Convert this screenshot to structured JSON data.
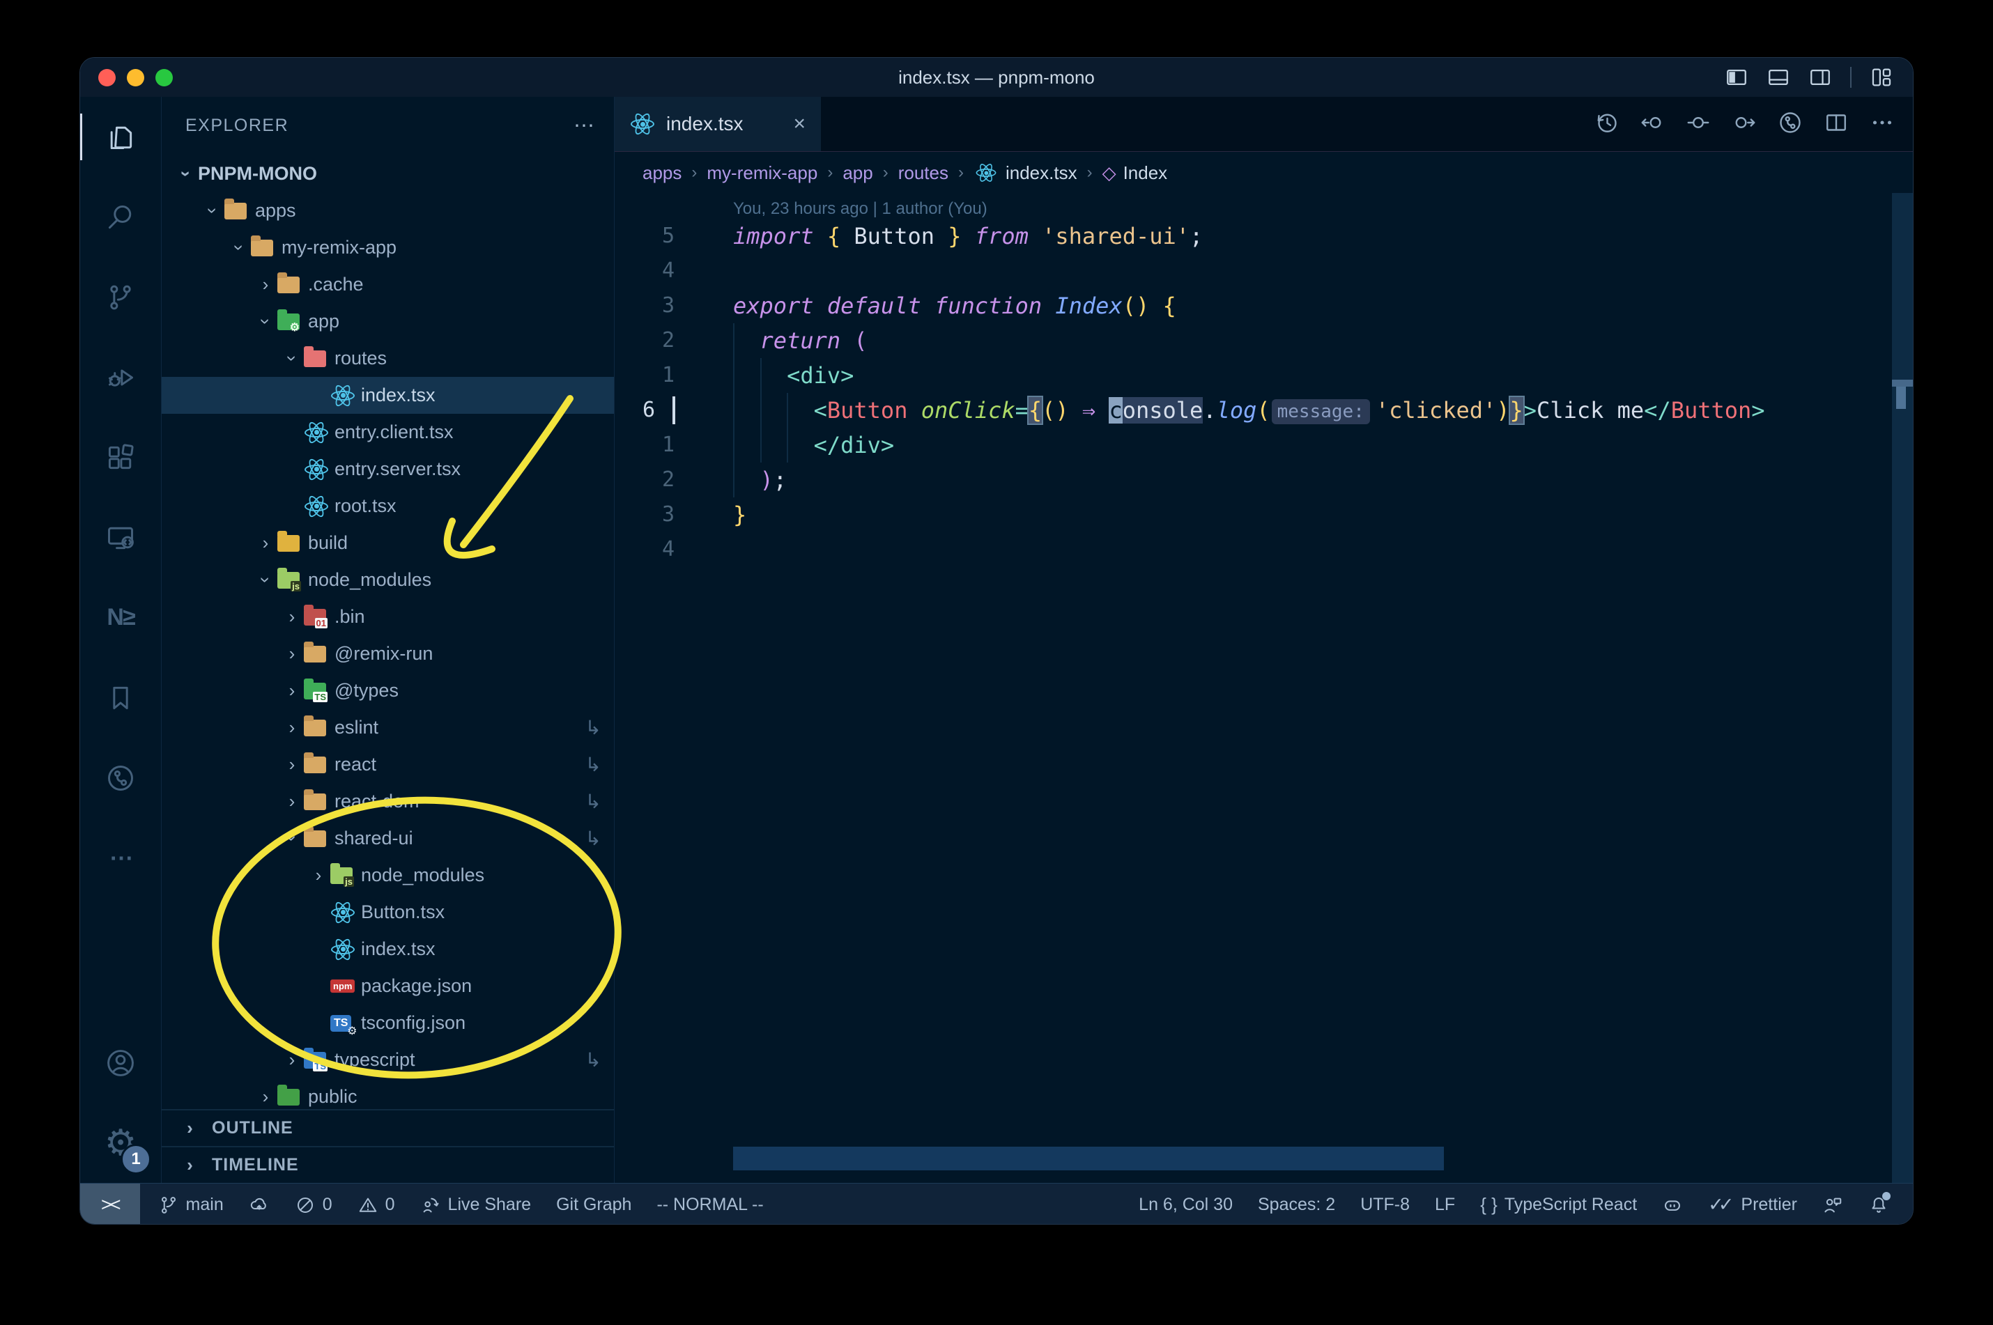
{
  "window": {
    "title": "index.tsx — pnpm-mono"
  },
  "titlebar": {
    "traffic_lights": [
      {
        "name": "close",
        "color": "#ff5f57"
      },
      {
        "name": "minimize",
        "color": "#febc2e"
      },
      {
        "name": "zoom",
        "color": "#28c840"
      }
    ],
    "layout_icons": [
      "layout-sidebar-left-icon",
      "layout-panel-icon",
      "layout-sidebar-right-icon",
      "customize-layout-icon"
    ]
  },
  "activity_bar": {
    "top": [
      {
        "name": "explorer",
        "icon": "files-icon",
        "active": true
      },
      {
        "name": "search",
        "icon": "search-icon"
      },
      {
        "name": "source-control",
        "icon": "source-control-icon"
      },
      {
        "name": "run-debug",
        "icon": "run-debug-icon"
      },
      {
        "name": "extensions",
        "icon": "extensions-icon"
      },
      {
        "name": "remote-explorer",
        "icon": "remote-explorer-icon"
      },
      {
        "name": "nx-console",
        "icon": "nx-icon",
        "text": "N≥"
      },
      {
        "name": "bookmarks",
        "icon": "bookmark-icon"
      },
      {
        "name": "gitlens",
        "icon": "gitlens-icon"
      },
      {
        "name": "more",
        "icon": "more-icon",
        "text": "⋯"
      }
    ],
    "bottom": [
      {
        "name": "accounts",
        "icon": "account-icon"
      },
      {
        "name": "settings",
        "icon": "settings-gear-icon",
        "text": "⚙",
        "badge": "1"
      }
    ]
  },
  "sidebar": {
    "header": {
      "title": "EXPLORER",
      "actions": "⋯"
    },
    "tree": [
      {
        "label": "PNPM-MONO",
        "level": 0,
        "chevron": "down",
        "icon": "none",
        "root": true
      },
      {
        "label": "apps",
        "level": 1,
        "chevron": "down",
        "icon": "folder",
        "color": "tan"
      },
      {
        "label": "my-remix-app",
        "level": 2,
        "chevron": "down",
        "icon": "folder",
        "color": "tan"
      },
      {
        "label": ".cache",
        "level": 3,
        "chevron": "right",
        "icon": "folder",
        "color": "tan"
      },
      {
        "label": "app",
        "level": 3,
        "chevron": "down",
        "icon": "folder",
        "color": "green",
        "badge": "⚙",
        "badgecls": "gear"
      },
      {
        "label": "routes",
        "level": 4,
        "chevron": "down",
        "icon": "folder",
        "color": "salmon"
      },
      {
        "label": "index.tsx",
        "level": 5,
        "chevron": "none",
        "icon": "react",
        "selected": true
      },
      {
        "label": "entry.client.tsx",
        "level": 4,
        "chevron": "none",
        "icon": "react"
      },
      {
        "label": "entry.server.tsx",
        "level": 4,
        "chevron": "none",
        "icon": "react"
      },
      {
        "label": "root.tsx",
        "level": 4,
        "chevron": "none",
        "icon": "react"
      },
      {
        "label": "build",
        "level": 3,
        "chevron": "right",
        "icon": "folder",
        "color": "amber"
      },
      {
        "label": "node_modules",
        "level": 3,
        "chevron": "down",
        "icon": "folder",
        "color": "lime",
        "badge": "js",
        "badgecls": "dark"
      },
      {
        "label": ".bin",
        "level": 4,
        "chevron": "right",
        "icon": "folder",
        "color": "red",
        "badge": "01",
        "badgecls": "white"
      },
      {
        "label": "@remix-run",
        "level": 4,
        "chevron": "right",
        "icon": "folder",
        "color": "tan"
      },
      {
        "label": "@types",
        "level": 4,
        "chevron": "right",
        "icon": "folder",
        "color": "green",
        "badge": "TS",
        "badgecls": "ts"
      },
      {
        "label": "eslint",
        "level": 4,
        "chevron": "right",
        "icon": "folder",
        "color": "tan",
        "symlink": true
      },
      {
        "label": "react",
        "level": 4,
        "chevron": "right",
        "icon": "folder",
        "color": "tan",
        "symlink": true
      },
      {
        "label": "react-dom",
        "level": 4,
        "chevron": "right",
        "icon": "folder",
        "color": "tan",
        "symlink": true
      },
      {
        "label": "shared-ui",
        "level": 4,
        "chevron": "down",
        "icon": "folder",
        "color": "tan",
        "symlink": true
      },
      {
        "label": "node_modules",
        "level": 5,
        "chevron": "right",
        "icon": "folder",
        "color": "lime",
        "badge": "js",
        "badgecls": "dark"
      },
      {
        "label": "Button.tsx",
        "level": 5,
        "chevron": "none",
        "icon": "react"
      },
      {
        "label": "index.tsx",
        "level": 5,
        "chevron": "none",
        "icon": "react"
      },
      {
        "label": "package.json",
        "level": 5,
        "chevron": "none",
        "icon": "npm"
      },
      {
        "label": "tsconfig.json",
        "level": 5,
        "chevron": "none",
        "icon": "tsconfig"
      },
      {
        "label": "typescript",
        "level": 4,
        "chevron": "right",
        "icon": "folder",
        "color": "blue",
        "badge": "TS",
        "badgecls": "tsb",
        "symlink": true
      },
      {
        "label": "public",
        "level": 3,
        "chevron": "right",
        "icon": "folder",
        "color": "green2"
      }
    ],
    "sections": [
      {
        "label": "OUTLINE"
      },
      {
        "label": "TIMELINE"
      }
    ],
    "section_chevron": "›"
  },
  "editor": {
    "tab": {
      "label": "index.tsx",
      "close": "×"
    },
    "toolbar_icons": [
      "history-icon",
      "prev-change-icon",
      "current-change-icon",
      "next-change-icon",
      "gitlens-graph-icon",
      "split-editor-icon",
      "more-icon"
    ],
    "breadcrumbs": [
      {
        "label": "apps"
      },
      {
        "label": "my-remix-app"
      },
      {
        "label": "app"
      },
      {
        "label": "routes"
      },
      {
        "label": "index.tsx",
        "icon": "react-icon",
        "plain": true
      },
      {
        "label": "Index",
        "icon": "symbol-cube-icon",
        "plain": true
      }
    ],
    "breadcrumb_separator": "›",
    "blame": "You, 23 hours ago | 1 author (You)",
    "code_lines": [
      {
        "num": "5",
        "guides": 0,
        "tokens": [
          {
            "t": "import",
            "c": "kw"
          },
          {
            "t": " ",
            "c": "fg"
          },
          {
            "t": "{",
            "c": "gold"
          },
          {
            "t": " Button ",
            "c": "fg"
          },
          {
            "t": "}",
            "c": "gold"
          },
          {
            "t": " ",
            "c": "fg"
          },
          {
            "t": "from",
            "c": "kw"
          },
          {
            "t": " ",
            "c": "fg"
          },
          {
            "t": "'shared-ui'",
            "c": "str"
          },
          {
            "t": ";",
            "c": "fg"
          }
        ]
      },
      {
        "num": "4",
        "guides": 0,
        "tokens": []
      },
      {
        "num": "3",
        "guides": 0,
        "tokens": [
          {
            "t": "export",
            "c": "kw"
          },
          {
            "t": " ",
            "c": "fg"
          },
          {
            "t": "default",
            "c": "kw"
          },
          {
            "t": " ",
            "c": "fg"
          },
          {
            "t": "function",
            "c": "kw"
          },
          {
            "t": " ",
            "c": "fg"
          },
          {
            "t": "Index",
            "c": "fn"
          },
          {
            "t": "()",
            "c": "gold"
          },
          {
            "t": " ",
            "c": "fg"
          },
          {
            "t": "{",
            "c": "gold"
          }
        ]
      },
      {
        "num": "2",
        "guides": 1,
        "tokens": [
          {
            "t": "return",
            "c": "kw"
          },
          {
            "t": " ",
            "c": "fg"
          },
          {
            "t": "(",
            "c": "pink"
          }
        ]
      },
      {
        "num": "1",
        "guides": 2,
        "tokens": [
          {
            "t": "<div>",
            "c": "tag"
          }
        ]
      },
      {
        "num": "6",
        "current": true,
        "guides": 3,
        "tokens": [
          {
            "t": "<",
            "c": "tag"
          },
          {
            "t": "Button",
            "c": "comp"
          },
          {
            "t": " ",
            "c": "fg"
          },
          {
            "t": "onClick",
            "c": "attr"
          },
          {
            "t": "=",
            "c": "tag"
          },
          {
            "t": "{",
            "c": "box"
          },
          {
            "t": "()",
            "c": "gold"
          },
          {
            "t": " ",
            "c": "fg"
          },
          {
            "t": "⇒",
            "c": "pink"
          },
          {
            "t": " ",
            "c": "fg"
          },
          {
            "t": "c",
            "c": "cursor"
          },
          {
            "t": "onsole",
            "c": "whl"
          },
          {
            "t": ".",
            "c": "fg"
          },
          {
            "t": "log",
            "c": "fn"
          },
          {
            "t": "(",
            "c": "gold"
          },
          {
            "t": "message:",
            "c": "inlay"
          },
          {
            "t": "'clicked'",
            "c": "str"
          },
          {
            "t": ")",
            "c": "gold"
          },
          {
            "t": "}",
            "c": "box"
          },
          {
            "t": ">",
            "c": "tag"
          },
          {
            "t": "Click me",
            "c": "fg"
          },
          {
            "t": "</",
            "c": "tag"
          },
          {
            "t": "Button",
            "c": "comp"
          },
          {
            "t": ">",
            "c": "tag"
          }
        ]
      },
      {
        "num": "1",
        "guides": 3,
        "tokens": [
          {
            "t": "</div>",
            "c": "tag"
          }
        ]
      },
      {
        "num": "2",
        "guides": 1,
        "tokens": [
          {
            "t": ")",
            "c": "pink"
          },
          {
            "t": ";",
            "c": "fg"
          }
        ]
      },
      {
        "num": "3",
        "guides": 0,
        "tokens": [
          {
            "t": "}",
            "c": "gold"
          }
        ]
      },
      {
        "num": "4",
        "guides": 0,
        "tokens": []
      }
    ]
  },
  "status_bar": {
    "left": [
      {
        "name": "remote",
        "kind": "remote",
        "text": "><"
      },
      {
        "name": "branch",
        "icon": "branch-icon",
        "text": "main"
      },
      {
        "name": "sync",
        "icon": "sync-icon",
        "text": ""
      },
      {
        "name": "errors",
        "icon": "error-icon",
        "text": "0"
      },
      {
        "name": "warnings",
        "icon": "warning-icon",
        "text": "0"
      },
      {
        "name": "live-share",
        "icon": "liveshare-icon",
        "text": "Live Share"
      },
      {
        "name": "git-graph",
        "text": "Git Graph"
      },
      {
        "name": "vim-mode",
        "text": "-- NORMAL --"
      }
    ],
    "right": [
      {
        "name": "cursor-position",
        "text": "Ln 6, Col 30"
      },
      {
        "name": "indentation",
        "text": "Spaces: 2"
      },
      {
        "name": "encoding",
        "text": "UTF-8"
      },
      {
        "name": "eol",
        "text": "LF"
      },
      {
        "name": "language-mode",
        "icon": "braces-icon",
        "text": "TypeScript React"
      },
      {
        "name": "copilot",
        "icon": "copilot-icon",
        "text": ""
      },
      {
        "name": "prettier",
        "icon": "check-double-icon",
        "text": "Prettier"
      },
      {
        "name": "feedback",
        "icon": "feedback-icon",
        "text": ""
      },
      {
        "name": "notifications",
        "icon": "bell-icon",
        "text": "",
        "dot": true
      }
    ]
  },
  "annotations": {
    "color": "#f2e33c"
  }
}
